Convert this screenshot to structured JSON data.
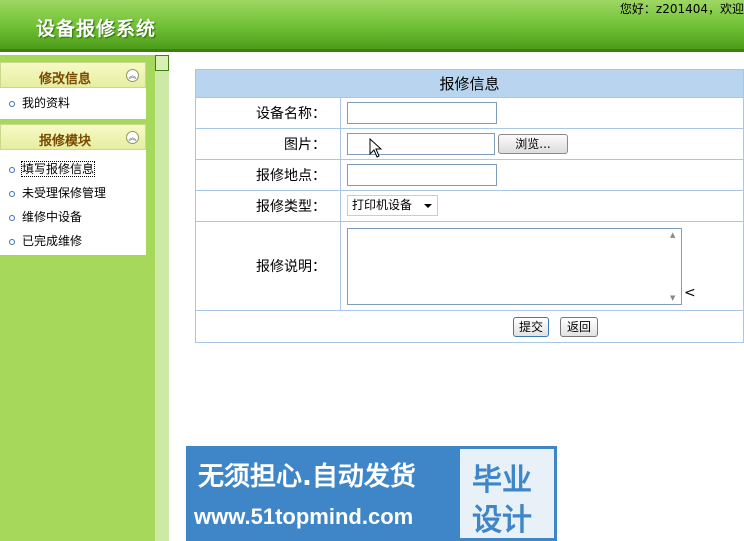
{
  "header": {
    "app_title": "设备报修系统",
    "welcome": "您好：z201404，欢迎"
  },
  "sidebar": {
    "sections": [
      {
        "title": "修改信息",
        "items": [
          "我的资料"
        ]
      },
      {
        "title": "报修模块",
        "items": [
          "填写报修信息",
          "未受理保修管理",
          "维修中设备",
          "已完成维修"
        ]
      }
    ]
  },
  "form": {
    "title": "报修信息",
    "labels": {
      "device_name": "设备名称：",
      "picture": "图片：",
      "location": "报修地点：",
      "type": "报修类型：",
      "description": "报修说明："
    },
    "values": {
      "device_name": "",
      "location": "",
      "type_selected": "打印机设备",
      "description": ""
    },
    "browse_label": "浏览...",
    "submit_label": "提交",
    "back_label": "返回"
  },
  "banner": {
    "line1": "无须担心.自动发货",
    "line2": "www.51topmind.com",
    "box_top": "毕业",
    "box_bottom": "设计"
  }
}
